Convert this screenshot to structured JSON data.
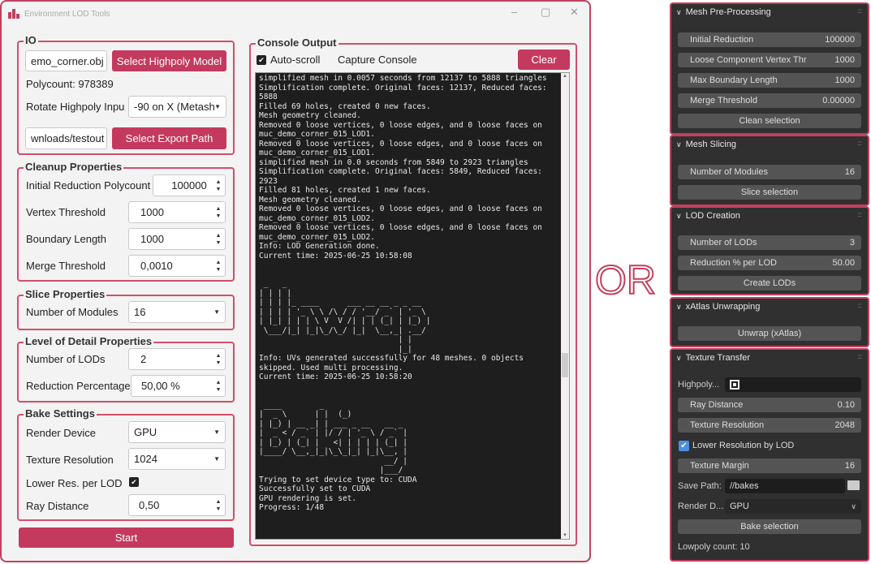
{
  "window": {
    "title": "Environment LOD Tools"
  },
  "io": {
    "title": "IO",
    "model_path": "emo_corner.obj",
    "select_highpoly_label": "Select Highpoly Model",
    "polycount": "Polycount: 978389",
    "rotate_label": "Rotate Highpoly Inpu",
    "rotate_value": "-90 on X (Metash",
    "export_path": "wnloads/testout",
    "select_export_label": "Select Export Path"
  },
  "cleanup": {
    "title": "Cleanup Properties",
    "initial_reduction_label": "Initial Reduction Polycount",
    "initial_reduction_value": "100000",
    "vertex_threshold_label": "Vertex Threshold",
    "vertex_threshold_value": "1000",
    "boundary_length_label": "Boundary Length",
    "boundary_length_value": "1000",
    "merge_threshold_label": "Merge Threshold",
    "merge_threshold_value": "0,0010"
  },
  "slice": {
    "title": "Slice Properties",
    "modules_label": "Number of Modules",
    "modules_value": "16"
  },
  "lod": {
    "title": "Level of Detail Properties",
    "lods_label": "Number of LODs",
    "lods_value": "2",
    "reduction_label": "Reduction Percentage",
    "reduction_value": "50,00 %"
  },
  "bake": {
    "title": "Bake Settings",
    "device_label": "Render Device",
    "device_value": "GPU",
    "texres_label": "Texture Resolution",
    "texres_value": "1024",
    "lowerres_label": "Lower Res. per LOD",
    "ray_label": "Ray Distance",
    "ray_value": "0,50"
  },
  "start_label": "Start",
  "console": {
    "title": "Console Output",
    "autoscroll_label": "Auto-scroll",
    "autoscroll_checked": true,
    "capture_label": "Capture Console",
    "capture_checked": false,
    "clear_label": "Clear",
    "text": "simplified mesh in 0.0057 seconds from 12137 to 5888 triangles\nSimplification complete. Original faces: 12137, Reduced faces:\n5888\nFilled 69 holes, created 0 new faces.\nMesh geometry cleaned.\nRemoved 0 loose vertices, 0 loose edges, and 0 loose faces on\nmuc_demo_corner_015_LOD1.\nRemoved 0 loose vertices, 0 loose edges, and 0 loose faces on\nmuc_demo_corner_015_LOD1.\nsimplified mesh in 0.0 seconds from 5849 to 2923 triangles\nSimplification complete. Original faces: 5849, Reduced faces:\n2923\nFilled 81 holes, created 1 new faces.\nMesh geometry cleaned.\nRemoved 0 loose vertices, 0 loose edges, and 0 loose faces on\nmuc_demo_corner_015_LOD2.\nRemoved 0 loose vertices, 0 loose edges, and 0 loose faces on\nmuc_demo_corner_015_LOD2.\nInfo: LOD Generation done.\nCurrent time: 2025-06-25 10:58:08\n\n\n _   _\n| | | |\n| | | |_ ____      ___ __ __ _ _ __\n| | | | '_ \\ \\ /\\ / / '__/ _` | '_ \\\n| |_| | | | \\ V  V /| | | (_| | |_) |\n \\___/|_| |_|\\_/\\_/ |_|  \\__,_| .__/\n                              | |\n                              |_|\nInfo: UVs generated successfully for 48 meshes. 0 objects\nskipped. Used multi processing.\nCurrent time: 2025-06-25 10:58:20\n\n\n ____        _\n|  _ \\      | |  (_)\n| |_) | __ _| | ___ _ __   __ _\n|  _ < / _` | |/ / | '_ \\ / _` |\n| |_) | (_| |   <| | | | | (_| |\n|____/ \\__,_|_|\\_\\_|_| |_|\\__, |\n                           __/ |\n                          |___/\nTrying to set device type to: CUDA\nSuccessfully set to CUDA\nGPU rendering is set.\nProgress: 1/48"
  },
  "or_label": "OR",
  "blender": {
    "preproc": {
      "title": "Mesh Pre-Processing",
      "fields": [
        {
          "label": "Initial Reduction",
          "value": "100000"
        },
        {
          "label": "Loose Component Vertex Thr",
          "value": "1000"
        },
        {
          "label": "Max Boundary Length",
          "value": "1000"
        },
        {
          "label": "Merge Threshold",
          "value": "0.00000"
        }
      ],
      "button": "Clean selection"
    },
    "slicing": {
      "title": "Mesh Slicing",
      "field": {
        "label": "Number of Modules",
        "value": "16"
      },
      "button": "Slice selection"
    },
    "lodcreation": {
      "title": "LOD Creation",
      "fields": [
        {
          "label": "Number of LODs",
          "value": "3"
        },
        {
          "label": "Reduction % per LOD",
          "value": "50.00"
        }
      ],
      "button": "Create LODs"
    },
    "xatlas": {
      "title": "xAtlas Unwrapping",
      "button": "Unwrap (xAtlas)"
    },
    "texture": {
      "title": "Texture Transfer",
      "highpoly_label": "Highpoly...",
      "fields": [
        {
          "label": "Ray Distance",
          "value": "0.10"
        },
        {
          "label": "Texture Resolution",
          "value": "2048"
        }
      ],
      "lower_res_label": "Lower Resolution by LOD",
      "lower_res_checked": true,
      "margin": {
        "label": "Texture Margin",
        "value": "16"
      },
      "save_label": "Save Path:",
      "save_value": "//bakes",
      "device_label": "Render D...",
      "device_value": "GPU",
      "button": "Bake selection",
      "lowpoly_count": "Lowpoly count: 10"
    }
  },
  "colors": {
    "accent": "#c43a5e",
    "blender_bg": "#303030",
    "blender_field": "#545454"
  }
}
